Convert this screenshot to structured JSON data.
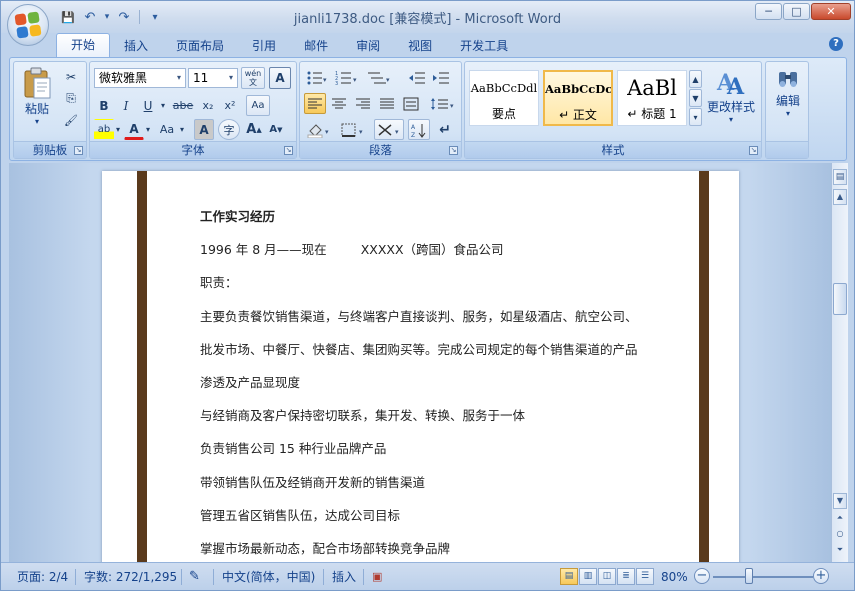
{
  "window": {
    "title": "jianli1738.doc [兼容模式] - Microsoft Word",
    "controls": {
      "minimize": "─",
      "maximize": "□",
      "close": "✕"
    }
  },
  "quick_access": {
    "save": "💾",
    "undo": "↶",
    "redo": "↷",
    "customize": "▾"
  },
  "tabs": [
    {
      "label": "开始"
    },
    {
      "label": "插入"
    },
    {
      "label": "页面布局"
    },
    {
      "label": "引用"
    },
    {
      "label": "邮件"
    },
    {
      "label": "审阅"
    },
    {
      "label": "视图"
    },
    {
      "label": "开发工具"
    }
  ],
  "help": "?",
  "ribbon": {
    "clipboard": {
      "label": "剪贴板",
      "paste_label": "粘贴",
      "cut": "✂",
      "copy": "⎘",
      "format_painter": "🖌"
    },
    "font": {
      "label": "字体",
      "font_name": "微软雅黑",
      "font_size": "11",
      "wen": "wén\n文",
      "bold": "B",
      "italic": "I",
      "underline": "U",
      "strike": "abe",
      "subscript": "x₂",
      "superscript": "x²",
      "clear": "Aa",
      "highlight": "ab",
      "font_color": "A",
      "case": "Aa",
      "char_shade": "A",
      "enclose": "字",
      "grow": "A",
      "shrink": "A",
      "phonetic": "A"
    },
    "paragraph": {
      "label": "段落"
    },
    "styles": {
      "label": "样式",
      "items": [
        {
          "sample": "AaBbCcDdl",
          "name": "要点"
        },
        {
          "sample": "AaBbCcDc",
          "name": "↵ 正文"
        },
        {
          "sample": "AaBl",
          "name": "↵ 标题 1"
        }
      ],
      "change_styles": "更改样式"
    },
    "editing": {
      "label": "编辑"
    }
  },
  "document": {
    "lines": [
      "工作实习经历",
      "1996 年 8 月——现在",
      "XXXXX（跨国）食品公司",
      "职责：",
      "主要负责餐饮销售渠道，与终端客户直接谈判、服务，如星级酒店、航空公司、",
      "批发市场、中餐厅、快餐店、集团购买等。完成公司规定的每个销售渠道的产品",
      "渗透及产品显现度",
      "与经销商及客户保持密切联系，集开发、转换、服务于一体",
      "负责销售公司 15 种行业品牌产品",
      "带领销售队伍及经销商开发新的销售渠道",
      "管理五省区销售队伍，达成公司目标",
      "掌握市场最新动态，配合市场部转换竞争品牌"
    ]
  },
  "statusbar": {
    "page": "页面: 2/4",
    "words": "字数: 272/1,295",
    "language": "中文(简体，中国)",
    "mode": "插入",
    "zoom": "80%"
  }
}
